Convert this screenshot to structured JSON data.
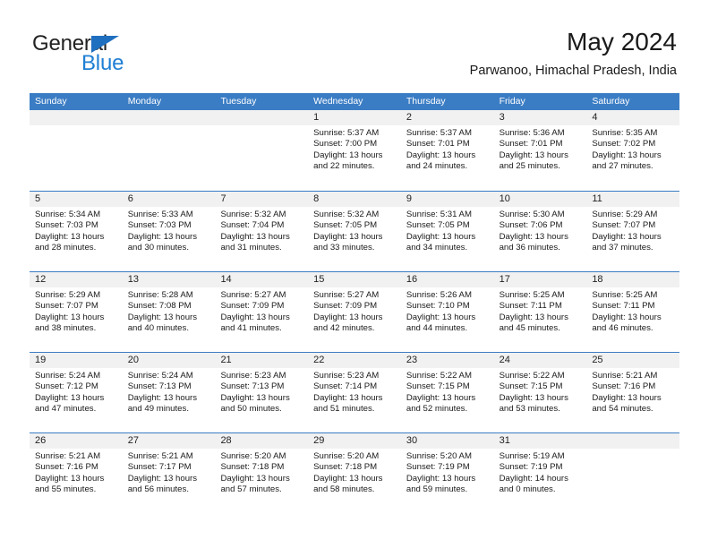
{
  "brand": {
    "name_part1": "General",
    "name_part2": "Blue",
    "triangle_color": "#1f6fc0",
    "blue_color": "#1f7fd4"
  },
  "header": {
    "title": "May 2024",
    "subtitle": "Parwanoo, Himachal Pradesh, India"
  },
  "theme": {
    "header_bg": "#3b7dc4",
    "day_band_bg": "#f1f1f1",
    "row_divider": "#3b7dc4"
  },
  "weekdays": [
    "Sunday",
    "Monday",
    "Tuesday",
    "Wednesday",
    "Thursday",
    "Friday",
    "Saturday"
  ],
  "weeks": [
    [
      {
        "day": "",
        "lines": []
      },
      {
        "day": "",
        "lines": []
      },
      {
        "day": "",
        "lines": []
      },
      {
        "day": "1",
        "lines": [
          "Sunrise: 5:37 AM",
          "Sunset: 7:00 PM",
          "Daylight: 13 hours",
          "and 22 minutes."
        ]
      },
      {
        "day": "2",
        "lines": [
          "Sunrise: 5:37 AM",
          "Sunset: 7:01 PM",
          "Daylight: 13 hours",
          "and 24 minutes."
        ]
      },
      {
        "day": "3",
        "lines": [
          "Sunrise: 5:36 AM",
          "Sunset: 7:01 PM",
          "Daylight: 13 hours",
          "and 25 minutes."
        ]
      },
      {
        "day": "4",
        "lines": [
          "Sunrise: 5:35 AM",
          "Sunset: 7:02 PM",
          "Daylight: 13 hours",
          "and 27 minutes."
        ]
      }
    ],
    [
      {
        "day": "5",
        "lines": [
          "Sunrise: 5:34 AM",
          "Sunset: 7:03 PM",
          "Daylight: 13 hours",
          "and 28 minutes."
        ]
      },
      {
        "day": "6",
        "lines": [
          "Sunrise: 5:33 AM",
          "Sunset: 7:03 PM",
          "Daylight: 13 hours",
          "and 30 minutes."
        ]
      },
      {
        "day": "7",
        "lines": [
          "Sunrise: 5:32 AM",
          "Sunset: 7:04 PM",
          "Daylight: 13 hours",
          "and 31 minutes."
        ]
      },
      {
        "day": "8",
        "lines": [
          "Sunrise: 5:32 AM",
          "Sunset: 7:05 PM",
          "Daylight: 13 hours",
          "and 33 minutes."
        ]
      },
      {
        "day": "9",
        "lines": [
          "Sunrise: 5:31 AM",
          "Sunset: 7:05 PM",
          "Daylight: 13 hours",
          "and 34 minutes."
        ]
      },
      {
        "day": "10",
        "lines": [
          "Sunrise: 5:30 AM",
          "Sunset: 7:06 PM",
          "Daylight: 13 hours",
          "and 36 minutes."
        ]
      },
      {
        "day": "11",
        "lines": [
          "Sunrise: 5:29 AM",
          "Sunset: 7:07 PM",
          "Daylight: 13 hours",
          "and 37 minutes."
        ]
      }
    ],
    [
      {
        "day": "12",
        "lines": [
          "Sunrise: 5:29 AM",
          "Sunset: 7:07 PM",
          "Daylight: 13 hours",
          "and 38 minutes."
        ]
      },
      {
        "day": "13",
        "lines": [
          "Sunrise: 5:28 AM",
          "Sunset: 7:08 PM",
          "Daylight: 13 hours",
          "and 40 minutes."
        ]
      },
      {
        "day": "14",
        "lines": [
          "Sunrise: 5:27 AM",
          "Sunset: 7:09 PM",
          "Daylight: 13 hours",
          "and 41 minutes."
        ]
      },
      {
        "day": "15",
        "lines": [
          "Sunrise: 5:27 AM",
          "Sunset: 7:09 PM",
          "Daylight: 13 hours",
          "and 42 minutes."
        ]
      },
      {
        "day": "16",
        "lines": [
          "Sunrise: 5:26 AM",
          "Sunset: 7:10 PM",
          "Daylight: 13 hours",
          "and 44 minutes."
        ]
      },
      {
        "day": "17",
        "lines": [
          "Sunrise: 5:25 AM",
          "Sunset: 7:11 PM",
          "Daylight: 13 hours",
          "and 45 minutes."
        ]
      },
      {
        "day": "18",
        "lines": [
          "Sunrise: 5:25 AM",
          "Sunset: 7:11 PM",
          "Daylight: 13 hours",
          "and 46 minutes."
        ]
      }
    ],
    [
      {
        "day": "19",
        "lines": [
          "Sunrise: 5:24 AM",
          "Sunset: 7:12 PM",
          "Daylight: 13 hours",
          "and 47 minutes."
        ]
      },
      {
        "day": "20",
        "lines": [
          "Sunrise: 5:24 AM",
          "Sunset: 7:13 PM",
          "Daylight: 13 hours",
          "and 49 minutes."
        ]
      },
      {
        "day": "21",
        "lines": [
          "Sunrise: 5:23 AM",
          "Sunset: 7:13 PM",
          "Daylight: 13 hours",
          "and 50 minutes."
        ]
      },
      {
        "day": "22",
        "lines": [
          "Sunrise: 5:23 AM",
          "Sunset: 7:14 PM",
          "Daylight: 13 hours",
          "and 51 minutes."
        ]
      },
      {
        "day": "23",
        "lines": [
          "Sunrise: 5:22 AM",
          "Sunset: 7:15 PM",
          "Daylight: 13 hours",
          "and 52 minutes."
        ]
      },
      {
        "day": "24",
        "lines": [
          "Sunrise: 5:22 AM",
          "Sunset: 7:15 PM",
          "Daylight: 13 hours",
          "and 53 minutes."
        ]
      },
      {
        "day": "25",
        "lines": [
          "Sunrise: 5:21 AM",
          "Sunset: 7:16 PM",
          "Daylight: 13 hours",
          "and 54 minutes."
        ]
      }
    ],
    [
      {
        "day": "26",
        "lines": [
          "Sunrise: 5:21 AM",
          "Sunset: 7:16 PM",
          "Daylight: 13 hours",
          "and 55 minutes."
        ]
      },
      {
        "day": "27",
        "lines": [
          "Sunrise: 5:21 AM",
          "Sunset: 7:17 PM",
          "Daylight: 13 hours",
          "and 56 minutes."
        ]
      },
      {
        "day": "28",
        "lines": [
          "Sunrise: 5:20 AM",
          "Sunset: 7:18 PM",
          "Daylight: 13 hours",
          "and 57 minutes."
        ]
      },
      {
        "day": "29",
        "lines": [
          "Sunrise: 5:20 AM",
          "Sunset: 7:18 PM",
          "Daylight: 13 hours",
          "and 58 minutes."
        ]
      },
      {
        "day": "30",
        "lines": [
          "Sunrise: 5:20 AM",
          "Sunset: 7:19 PM",
          "Daylight: 13 hours",
          "and 59 minutes."
        ]
      },
      {
        "day": "31",
        "lines": [
          "Sunrise: 5:19 AM",
          "Sunset: 7:19 PM",
          "Daylight: 14 hours",
          "and 0 minutes."
        ]
      },
      {
        "day": "",
        "lines": []
      }
    ]
  ]
}
